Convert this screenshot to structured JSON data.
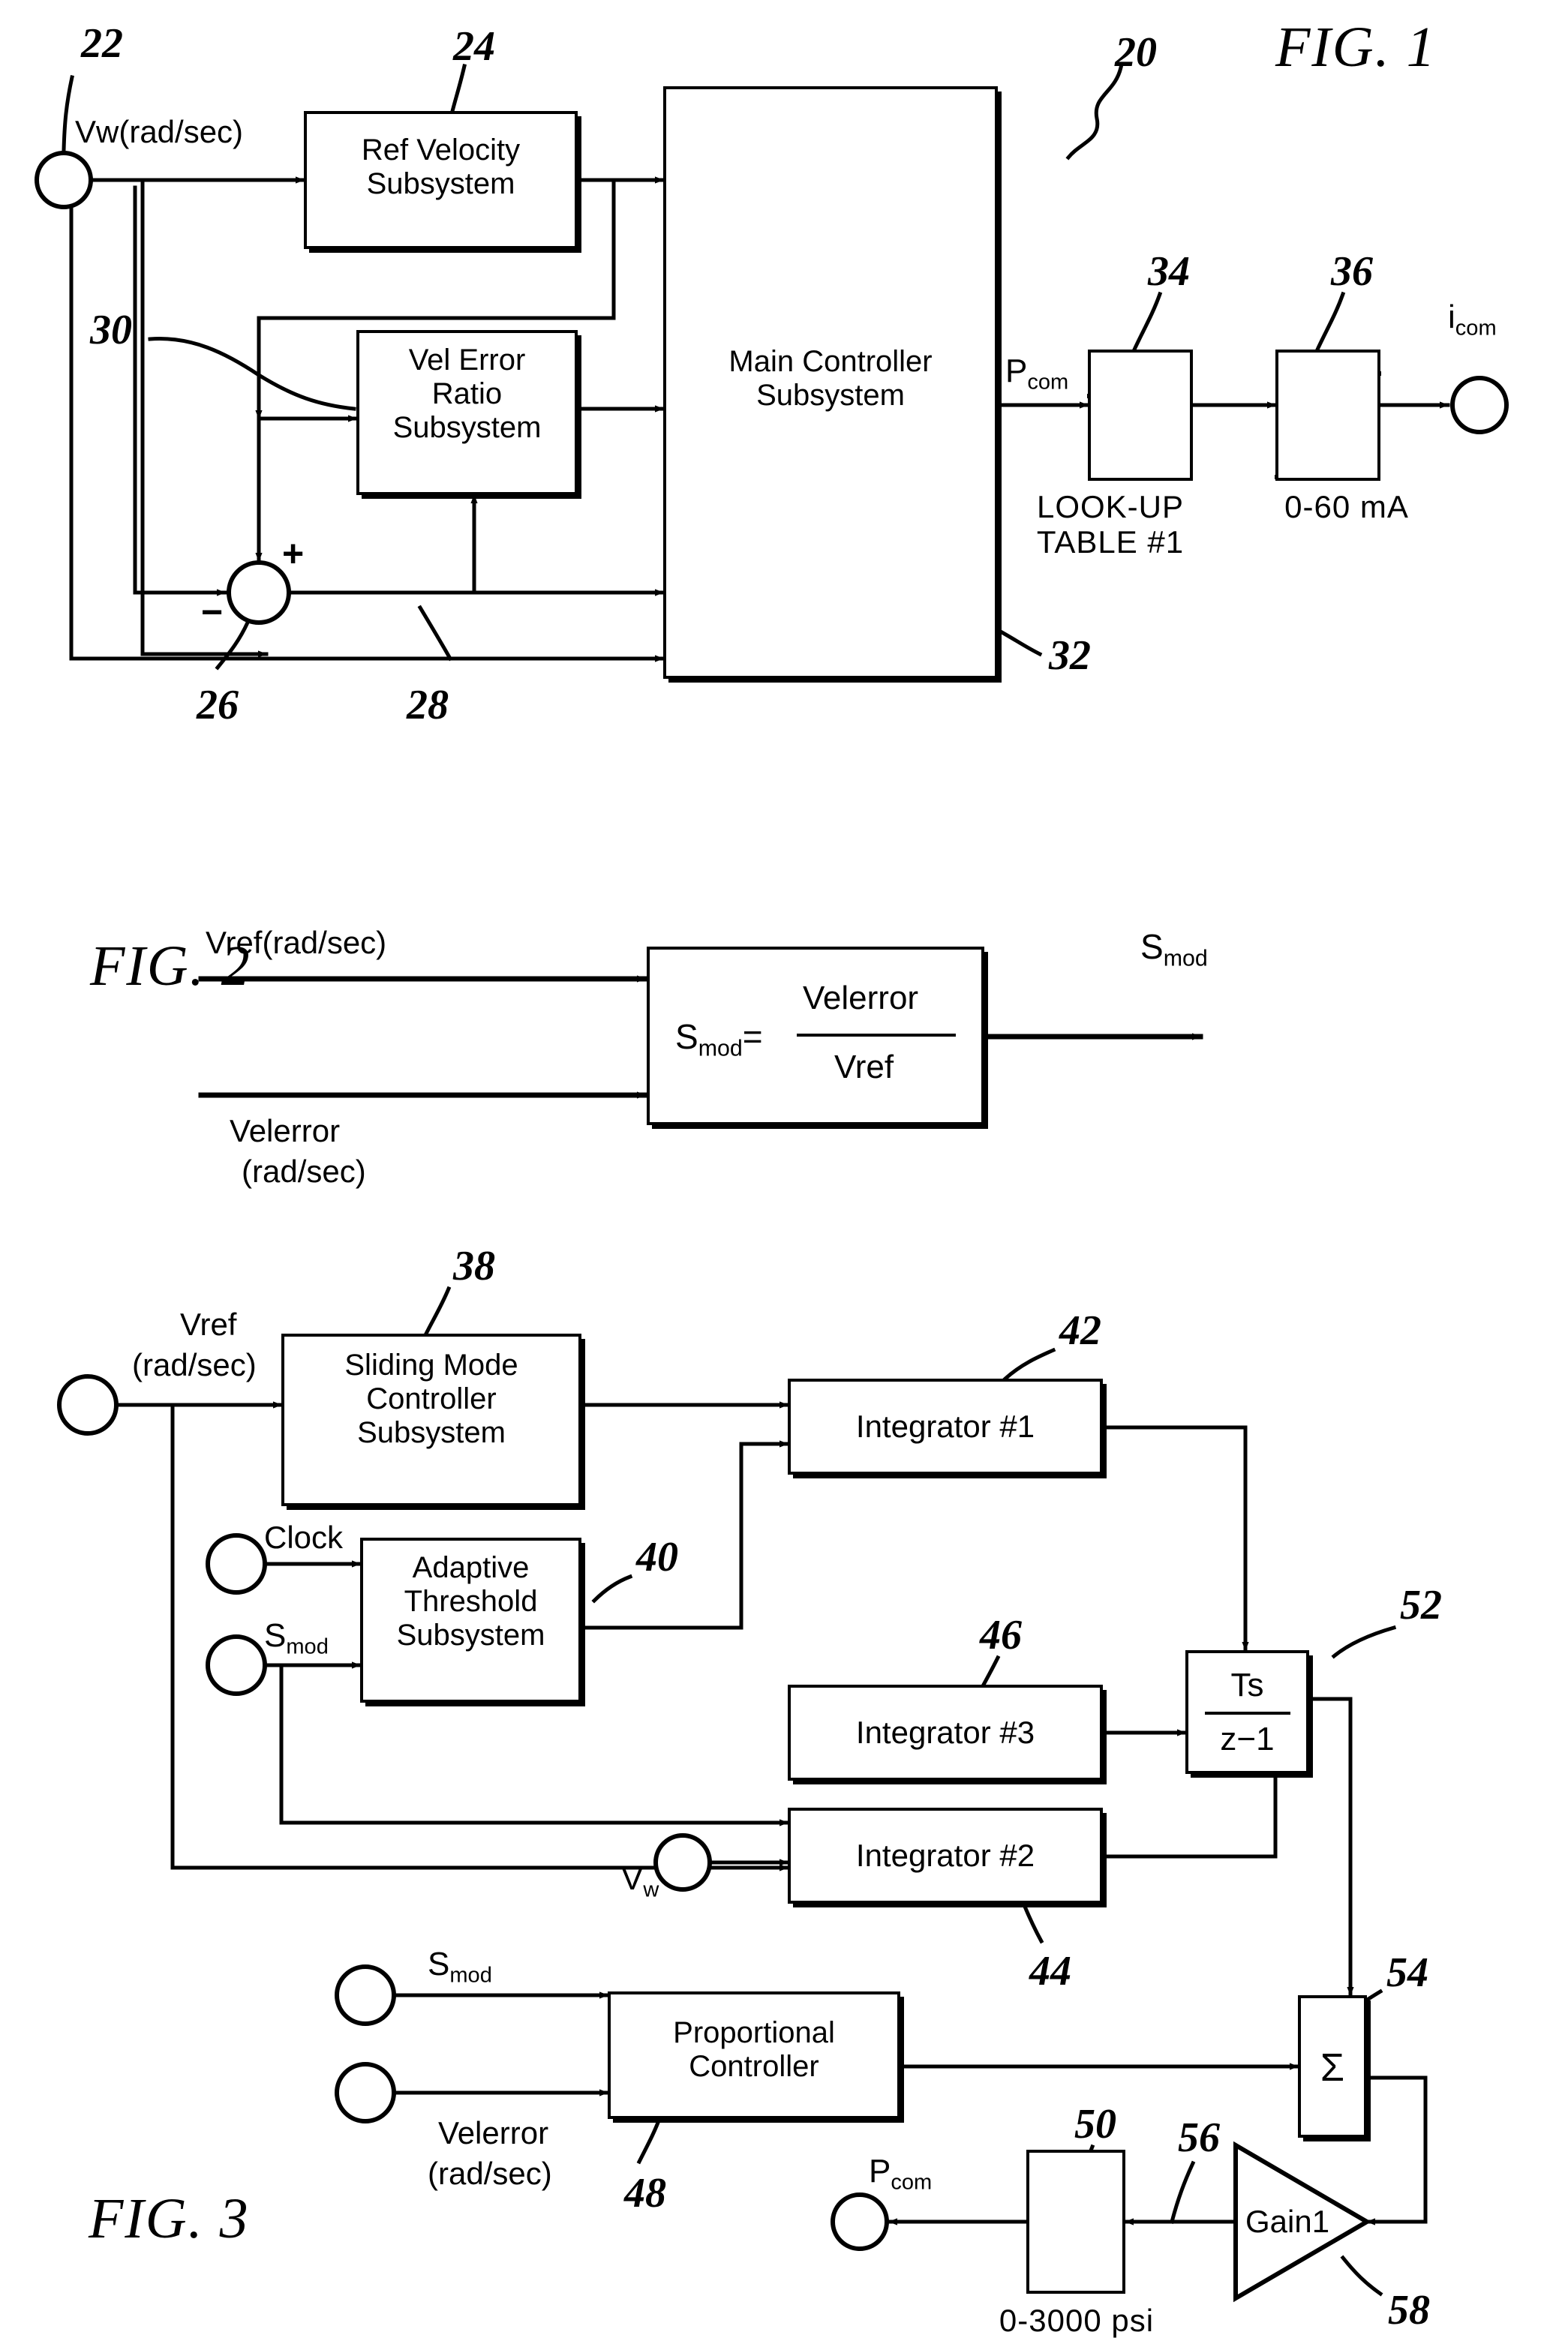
{
  "figures": [
    {
      "id": "fig1",
      "title": "FIG.  1",
      "ref": "20",
      "blocks": [
        {
          "name": "ref-velocity-subsystem",
          "label": "Ref  Velocity\nSubsystem",
          "ref": "24"
        },
        {
          "name": "vel-error-ratio-subsystem",
          "label": "Vel  Error\nRatio\nSubsystem",
          "ref": "30"
        },
        {
          "name": "main-controller-subsystem",
          "label": "Main  Controller\nSubsystem",
          "ref": "32"
        },
        {
          "name": "lookup-table-block",
          "label": "",
          "ref": "34",
          "caption": "LOOK-UP\nTABLE  #1"
        },
        {
          "name": "current-driver-block",
          "label": "",
          "ref": "36",
          "caption": "0-60  mA"
        }
      ],
      "signals": {
        "input_vw": "Vw(rad/sec)",
        "input_ref": "22",
        "p_com": "P",
        "p_com_sub": "com",
        "i_com": "i",
        "i_com_sub": "com",
        "sum_plus": "+",
        "sum_minus": "−",
        "sum_ref": "26",
        "feedback_ref": "28"
      }
    },
    {
      "id": "fig2",
      "title": "FIG.  2",
      "blocks": [
        {
          "name": "smod-equation-block",
          "lhs": "S",
          "lhs_sub": "mod",
          "eq": "=",
          "num": "Velerror",
          "den": "Vref"
        }
      ],
      "signals": {
        "in_top": "Vref(rad/sec)",
        "in_bottom_line1": "Velerror",
        "in_bottom_line2": "(rad/sec)",
        "out": "S",
        "out_sub": "mod"
      }
    },
    {
      "id": "fig3",
      "title": "FIG.  3",
      "blocks": [
        {
          "name": "sliding-mode-controller-subsystem",
          "label": "Sliding  Mode\nController\nSubsystem",
          "ref": "38"
        },
        {
          "name": "adaptive-threshold-subsystem",
          "label": "Adaptive\nThreshold\nSubsystem",
          "ref": "40"
        },
        {
          "name": "integrator-1",
          "label": "Integrator  #1",
          "ref": "42"
        },
        {
          "name": "integrator-3",
          "label": "Integrator  #3",
          "ref": "46"
        },
        {
          "name": "integrator-2",
          "label": "Integrator  #2",
          "ref": "44"
        },
        {
          "name": "discrete-transfer-block",
          "num": "Ts",
          "den": "z−1",
          "ref": "52"
        },
        {
          "name": "summing-block",
          "label": "Σ",
          "ref": "54"
        },
        {
          "name": "proportional-controller",
          "label": "Proportional\nController",
          "ref": "48"
        },
        {
          "name": "pressure-saturation-block",
          "label": "",
          "ref": "50",
          "caption": "0-3000  psi"
        },
        {
          "name": "gain-block",
          "label": "Gain1",
          "ref": "58",
          "lead_ref": "56"
        }
      ],
      "signals": {
        "vref_line1": "Vref",
        "vref_line2": "(rad/sec)",
        "clock": "Clock",
        "smod_upper": "S",
        "smod_upper_sub": "mod",
        "vw": "V",
        "vw_sub": "w",
        "smod_lower": "S",
        "smod_lower_sub": "mod",
        "velerror_line1": "Velerror",
        "velerror_line2": "(rad/sec)",
        "p_com": "P",
        "p_com_sub": "com"
      }
    }
  ],
  "colors": {
    "ink": "#000000",
    "paper": "#ffffff"
  }
}
